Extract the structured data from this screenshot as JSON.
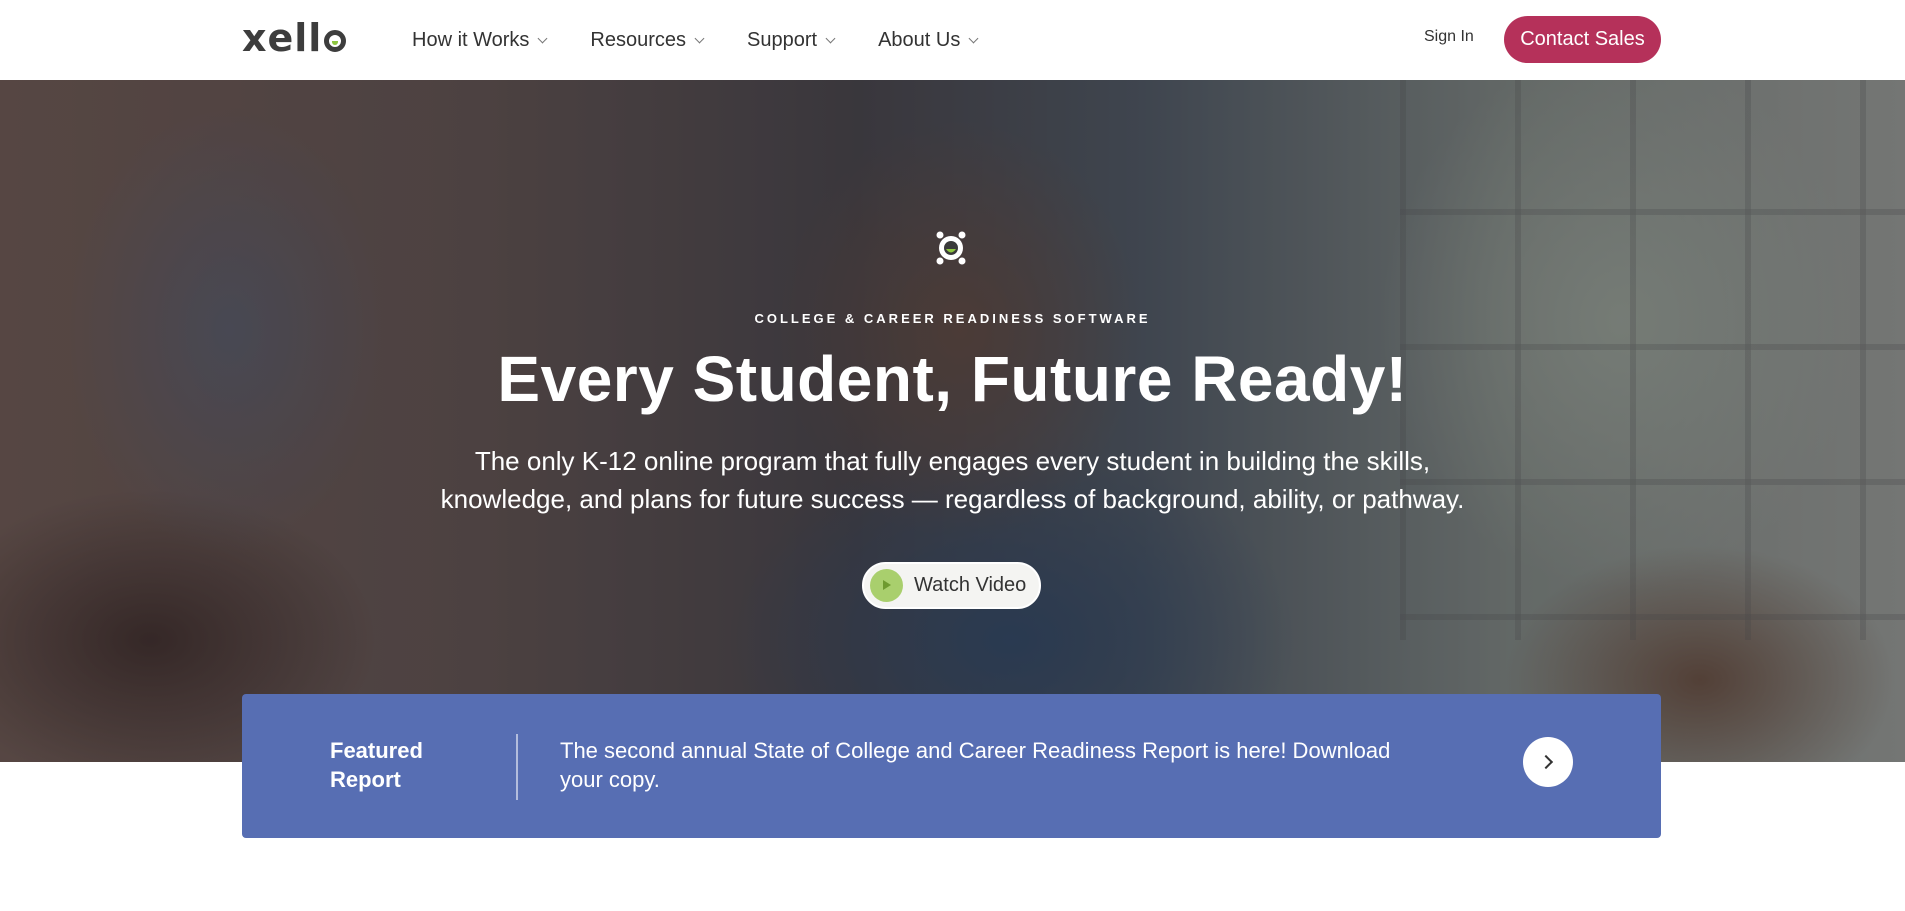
{
  "header": {
    "logo_text": "xell",
    "nav": [
      {
        "label": "How it Works"
      },
      {
        "label": "Resources"
      },
      {
        "label": "Support"
      },
      {
        "label": "About Us"
      }
    ],
    "sign_in": "Sign In",
    "contact_sales": "Contact Sales"
  },
  "hero": {
    "icon": "xello-robot-icon",
    "eyebrow": "COLLEGE & CAREER READINESS SOFTWARE",
    "title": "Every Student, Future Ready!",
    "subtitle_line1": "The only K-12 online program that fully engages every student in building the skills,",
    "subtitle_line2": "knowledge, and plans for future success — regardless of background, ability, or pathway.",
    "watch_video": "Watch Video"
  },
  "featured": {
    "label_line1": "Featured",
    "label_line2": "Report",
    "text_line1": "The second annual State of College and Career Readiness Report is here! Download",
    "text_line2": "your copy."
  },
  "colors": {
    "brand_accent": "#b5315a",
    "banner": "#576eb3",
    "play_green": "#a9cf6d"
  }
}
